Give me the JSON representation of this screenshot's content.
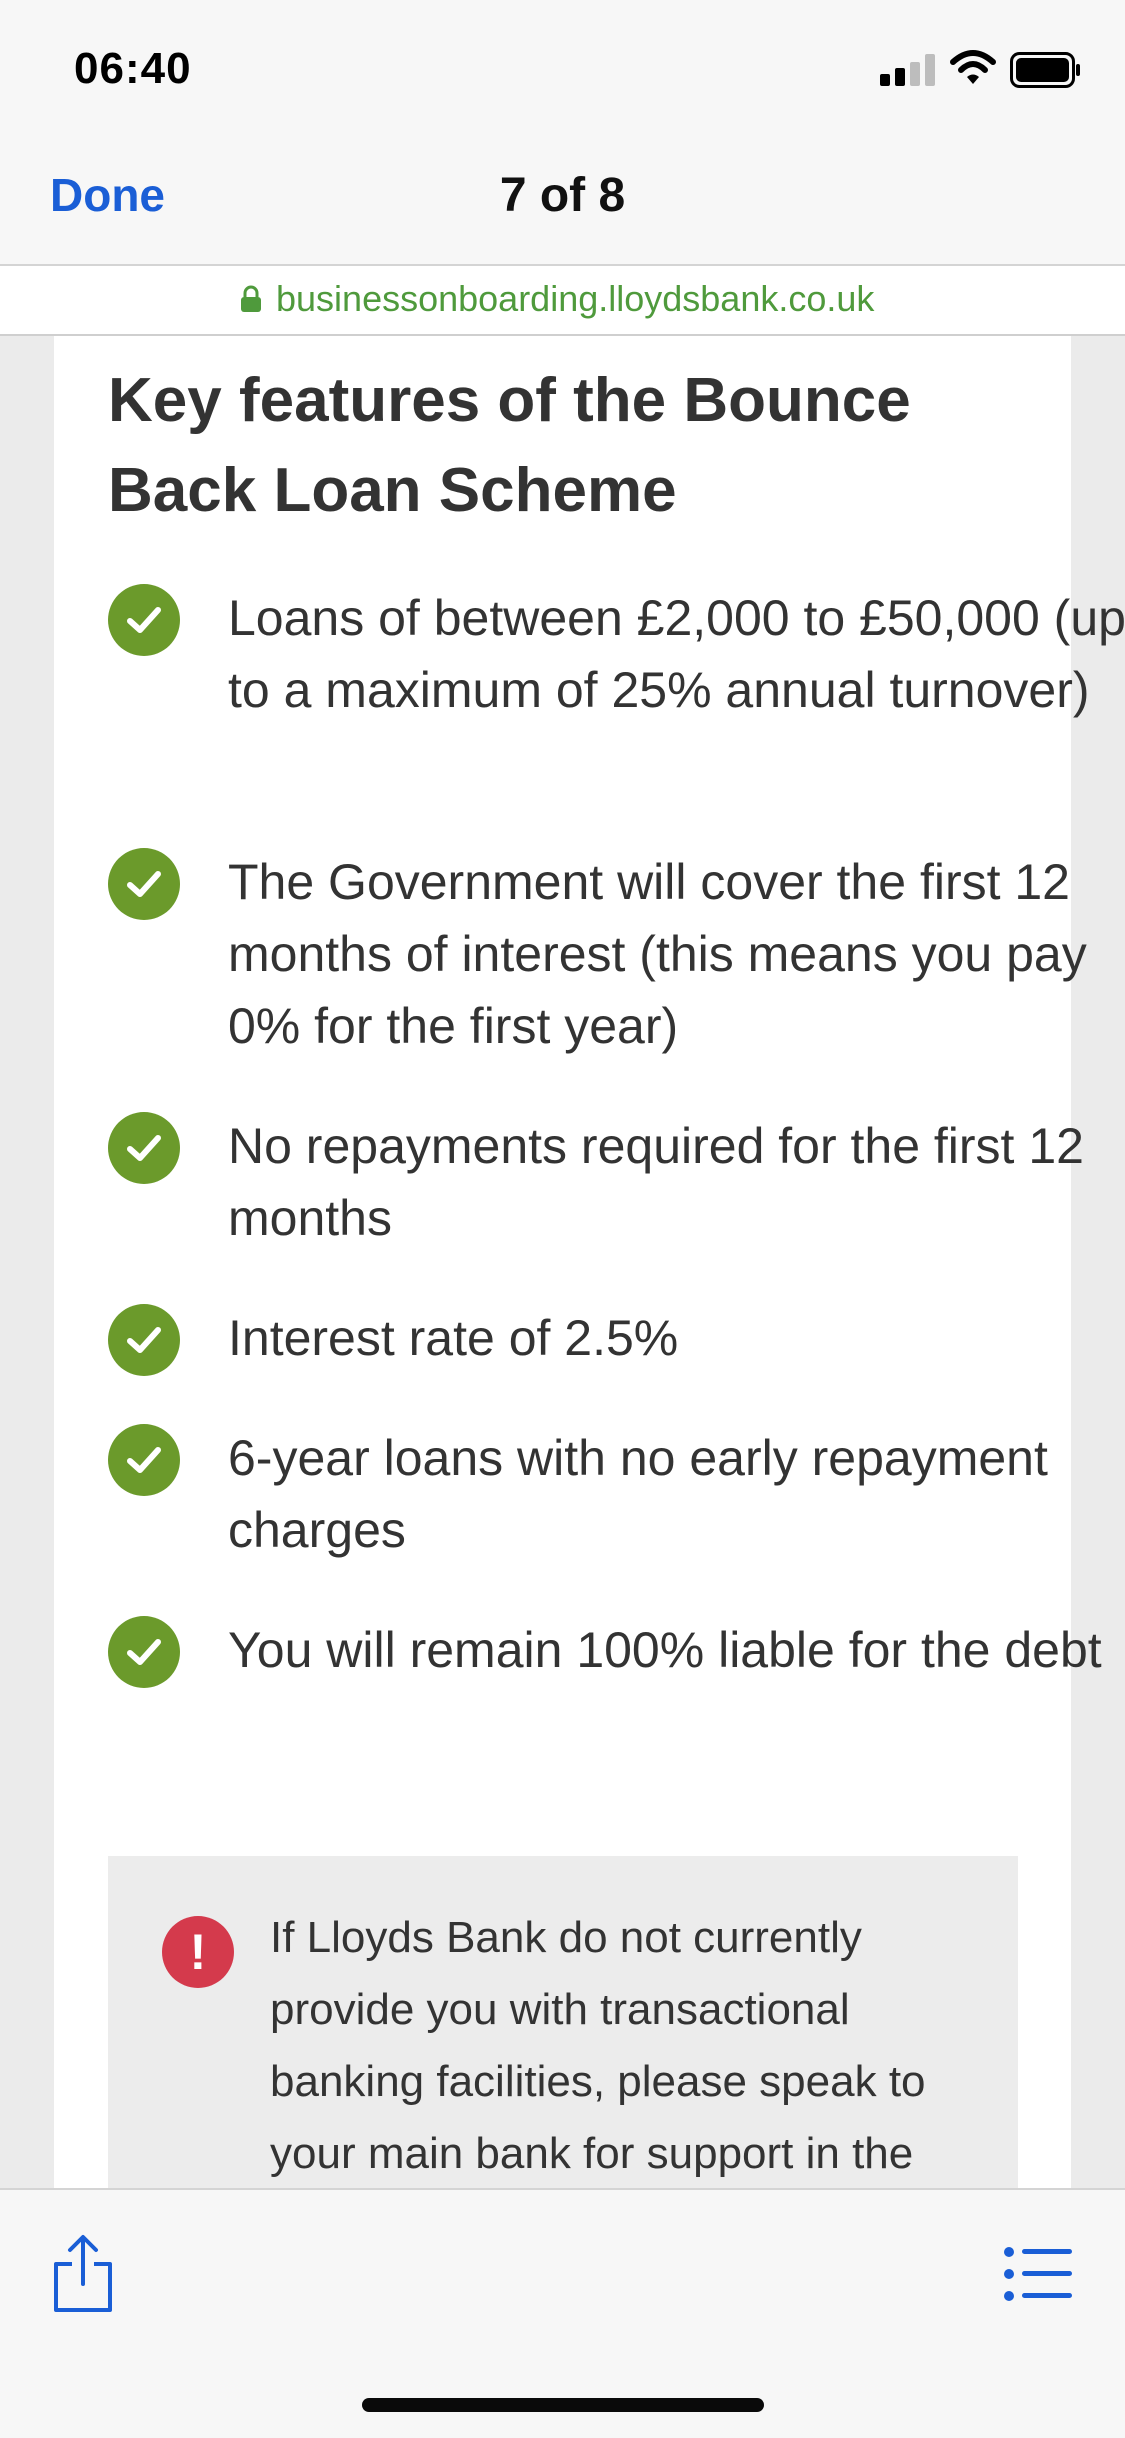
{
  "status_bar": {
    "time": "06:40"
  },
  "navbar": {
    "done_label": "Done",
    "page_count": "7 of 8"
  },
  "url_bar": {
    "url": "businessonboarding.lloydsbank.co.uk"
  },
  "content": {
    "heading": "Key features of the Bounce Back Loan Scheme",
    "features": [
      "Loans of between £2,000 to £50,000 (up to a maximum of 25% annual turnover)",
      "The Government will cover the first 12 months of interest (this means you pay 0% for the first year)",
      "No repayments required for the first 12 months",
      "Interest rate of 2.5%",
      "6-year loans with no early repayment charges",
      "You will remain 100% liable for the debt"
    ],
    "notice": {
      "icon_glyph": "!",
      "text": "If Lloyds Bank do not currently provide you with transactional banking facilities, please speak to your main bank for support in the"
    }
  },
  "colors": {
    "accent": "#1a5ed6",
    "check": "#6b9a2b",
    "alert": "#d43a4c",
    "url": "#4f9a3c"
  },
  "icons": [
    "signal-icon",
    "wifi-icon",
    "battery-icon",
    "lock-icon",
    "check-icon",
    "alert-icon",
    "share-icon",
    "list-icon"
  ]
}
